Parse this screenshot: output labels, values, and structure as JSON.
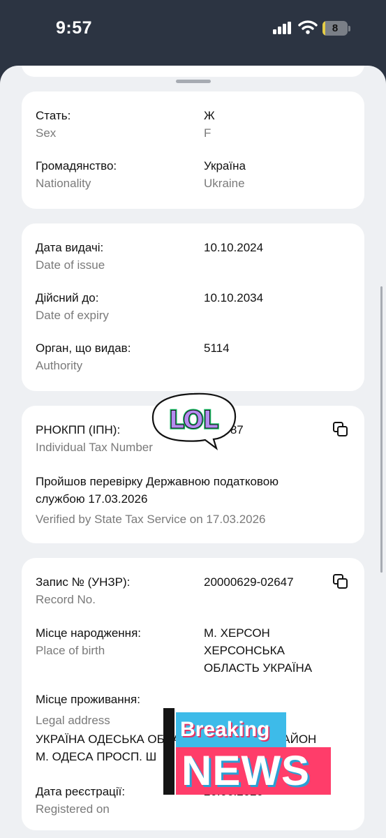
{
  "status_bar": {
    "time": "9:57",
    "battery": "8",
    "battery_level": 0.08
  },
  "card_personal": {
    "sex": {
      "label": "Стать:",
      "sublabel": "Sex",
      "value": "Ж",
      "value_sub": "F"
    },
    "nationality": {
      "label": "Громадянство:",
      "sublabel": "Nationality",
      "value": "Україна",
      "value_sub": "Ukraine"
    }
  },
  "card_dates": {
    "issue": {
      "label": "Дата видачі:",
      "sublabel": "Date of issue",
      "value": "10.10.2024"
    },
    "expiry": {
      "label": "Дійсний до:",
      "sublabel": "Date of expiry",
      "value": "10.10.2034"
    },
    "authority": {
      "label": "Орган, що видав:",
      "sublabel": "Authority",
      "value": "5114"
    }
  },
  "card_tax": {
    "label": "РНОКПП (ІПН):",
    "sublabel": "Individual Tax Number",
    "value": "509887",
    "verified_line1": "Пройшов перевірку Державною податковою",
    "verified_line2": "службою 17.03.2026",
    "verified_en": "Verified by State Tax Service on 17.03.2026"
  },
  "card_record": {
    "record": {
      "label": "Запис № (УНЗР):",
      "sublabel": "Record No.",
      "value": "20000629-02647"
    },
    "birthplace": {
      "label": "Місце народження:",
      "sublabel": "Place of birth",
      "line1": "М. ХЕРСОН",
      "line2": "ХЕРСОНСЬКА",
      "line3": "ОБЛАСТЬ УКРАЇНА"
    },
    "address": {
      "label": "Місце проживання:",
      "sublabel": "Legal address",
      "line1": "УКРАЇНА ОДЕСЬКА ОБЛАСТЬ ОДЕСЬКИЙ РАЙОН",
      "line2": "М. ОДЕСА ПРОСП. Ш"
    },
    "registered": {
      "label": "Дата реєстрації:",
      "sublabel": "Registered on",
      "value": "20.06.2020"
    }
  },
  "stickers": {
    "lol": "LOL",
    "breaking": "Breaking",
    "news": "NEWS"
  },
  "icons": {
    "copy": "copy-icon",
    "signal": "cellular-signal-icon",
    "wifi": "wifi-icon",
    "battery": "battery-icon"
  },
  "colors": {
    "background": "#2c3442",
    "sheet": "#eef0f3",
    "card": "#ffffff",
    "battery": "#e4cc45",
    "lol_fill": "#b48cf0",
    "lol_outline": "#1dbf6a",
    "news_blue": "#3dbbe9",
    "news_pink": "#ff3d6a"
  }
}
